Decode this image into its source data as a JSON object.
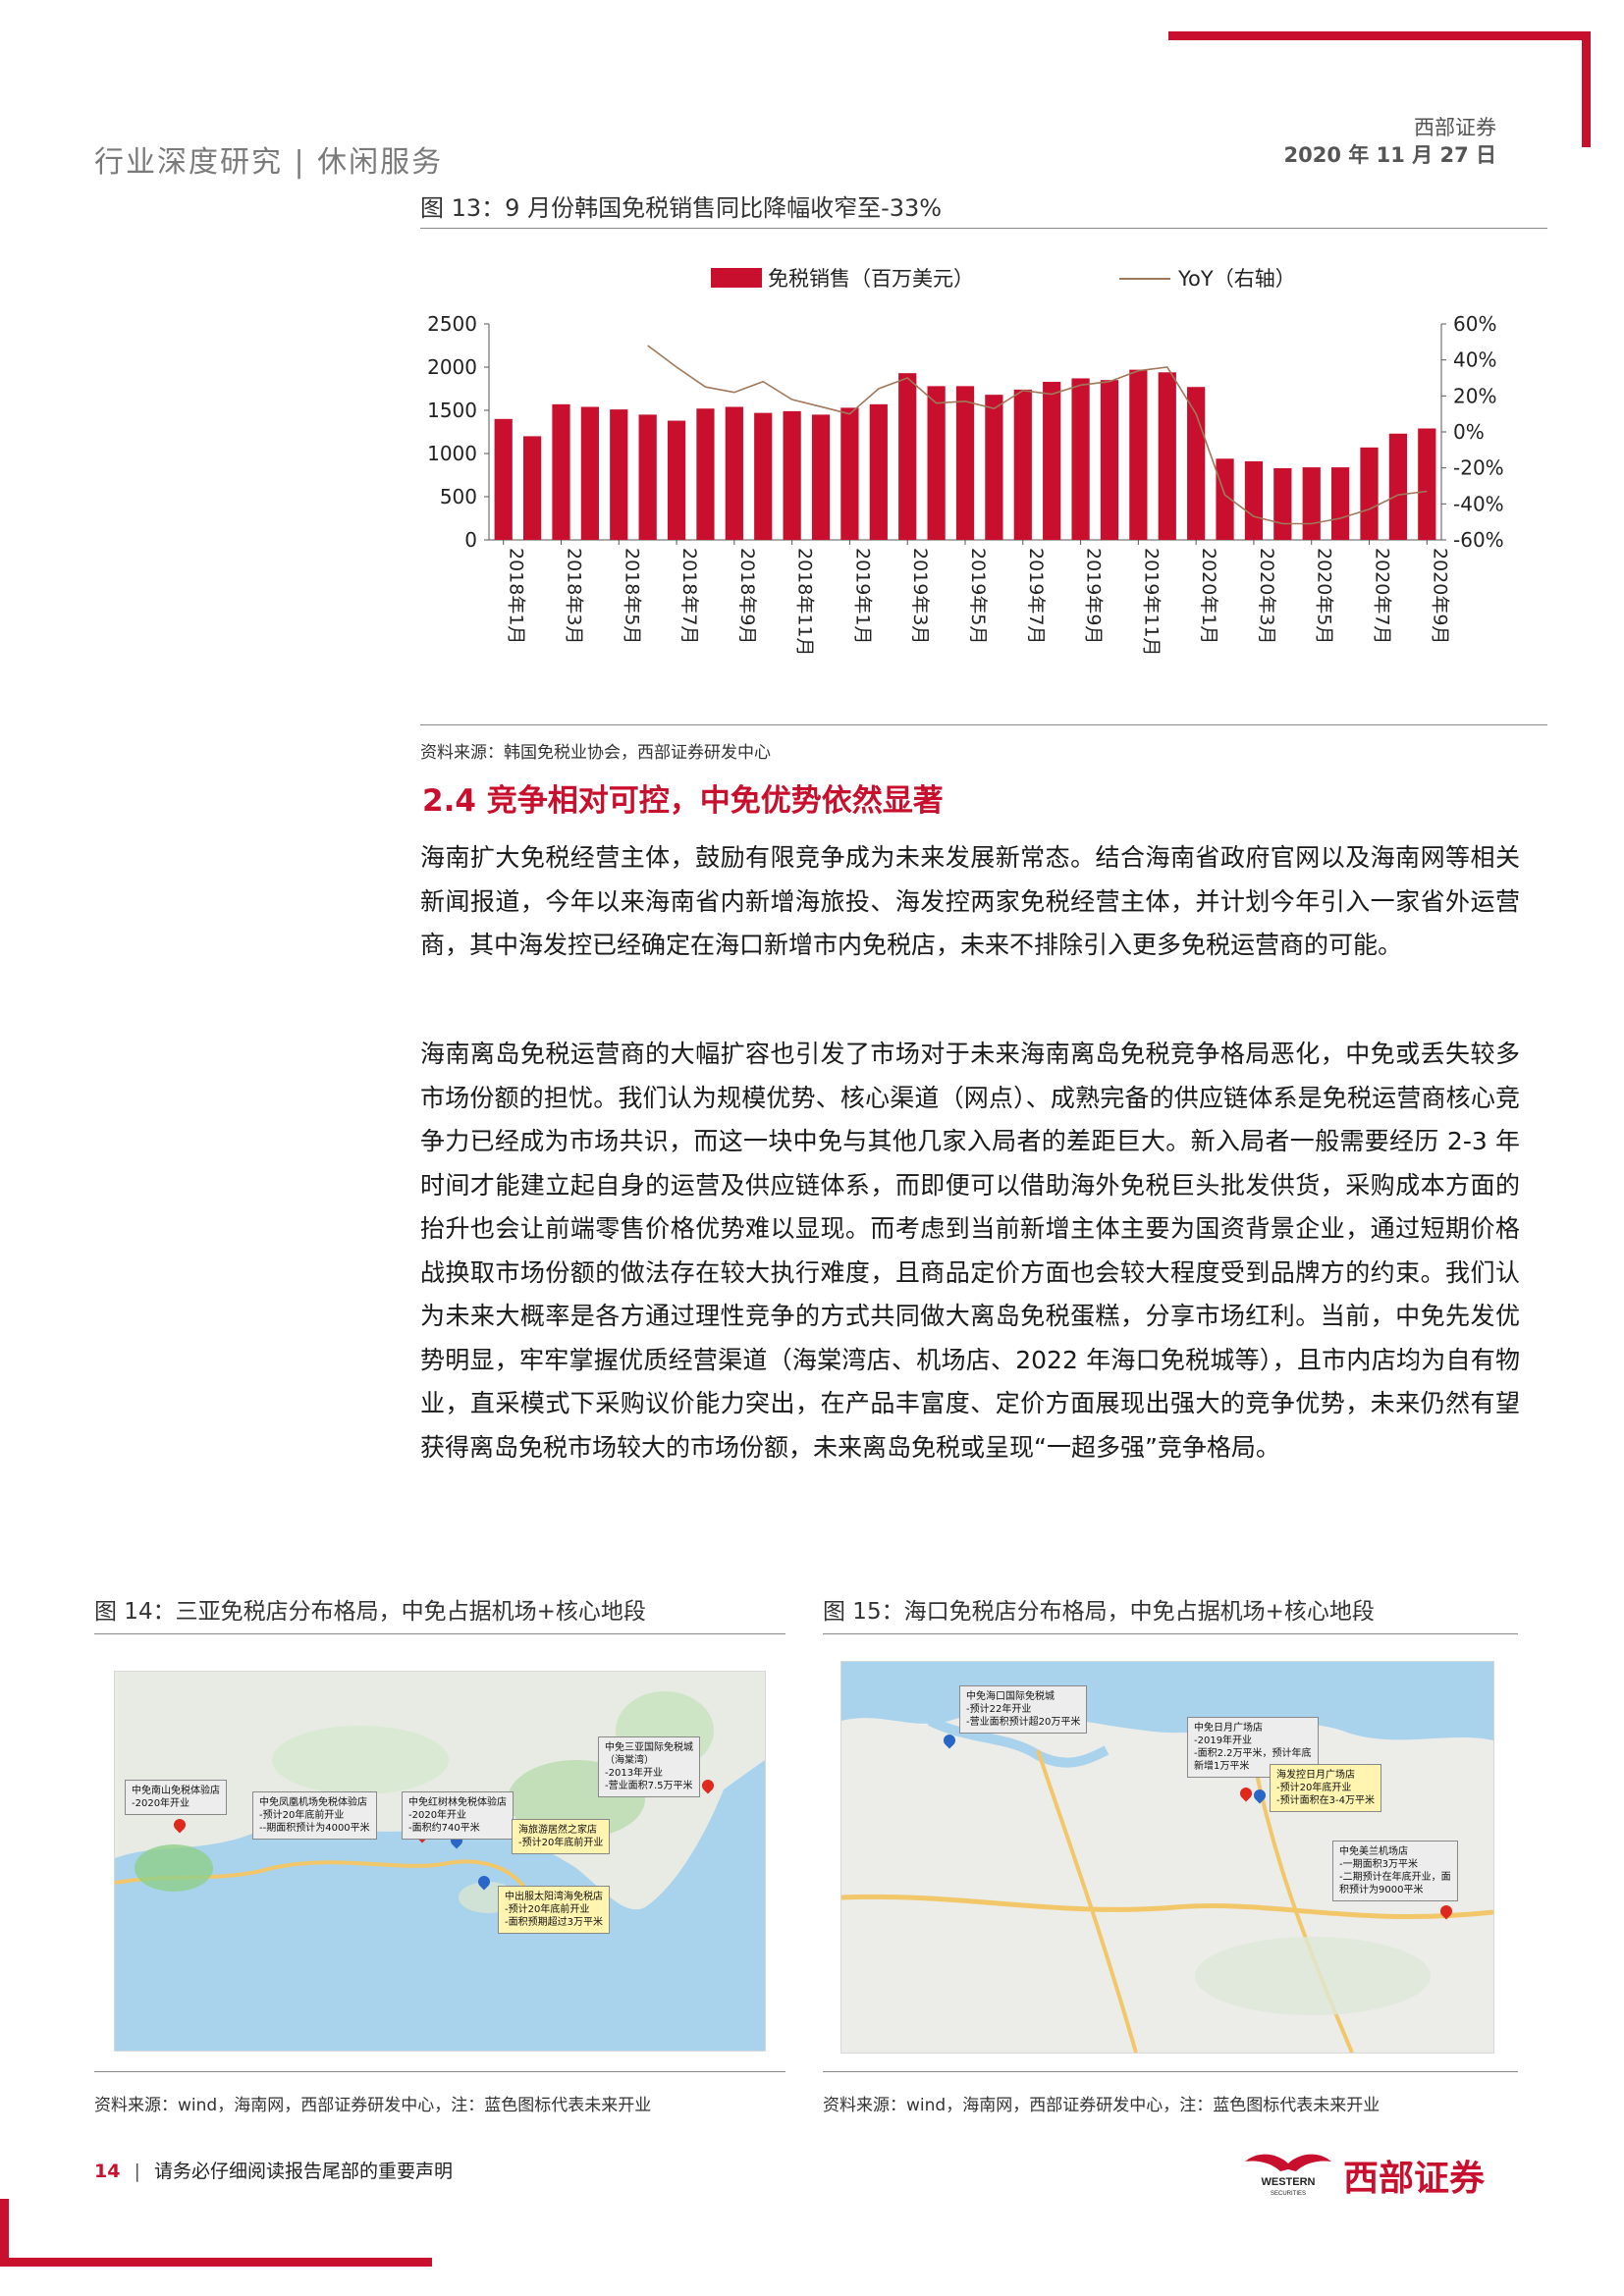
{
  "header": {
    "category": "行业深度研究 | 休闲服务",
    "company": "西部证券",
    "date": "2020 年 11 月 27 日"
  },
  "figure13": {
    "title": "图 13：9 月份韩国免税销售同比降幅收窄至-33%",
    "source": "资料来源：韩国免税业协会，西部证券研发中心"
  },
  "chart_data": {
    "type": "bar",
    "title": "图 13：9 月份韩国免税销售同比降幅收窄至-33%",
    "categories": [
      "2018年1月",
      "2018年2月",
      "2018年3月",
      "2018年4月",
      "2018年5月",
      "2018年6月",
      "2018年7月",
      "2018年8月",
      "2018年9月",
      "2018年10月",
      "2018年11月",
      "2018年12月",
      "2019年1月",
      "2019年2月",
      "2019年3月",
      "2019年4月",
      "2019年5月",
      "2019年6月",
      "2019年7月",
      "2019年8月",
      "2019年9月",
      "2019年10月",
      "2019年11月",
      "2019年12月",
      "2020年1月",
      "2020年2月",
      "2020年3月",
      "2020年4月",
      "2020年5月",
      "2020年6月",
      "2020年7月",
      "2020年8月",
      "2020年9月"
    ],
    "tick_labels": [
      "2018年1月",
      "2018年3月",
      "2018年5月",
      "2018年7月",
      "2018年9月",
      "2018年11月",
      "2019年1月",
      "2019年3月",
      "2019年5月",
      "2019年7月",
      "2019年9月",
      "2019年11月",
      "2020年1月",
      "2020年3月",
      "2020年5月",
      "2020年7月",
      "2020年9月"
    ],
    "series": [
      {
        "name": "免税销售（百万美元）",
        "type": "bar",
        "axis": "left",
        "color": "#c8102e",
        "values": [
          1400,
          1200,
          1570,
          1540,
          1510,
          1450,
          1380,
          1520,
          1540,
          1470,
          1490,
          1450,
          1530,
          1570,
          1930,
          1780,
          1780,
          1680,
          1740,
          1830,
          1870,
          1850,
          1970,
          1940,
          1770,
          940,
          910,
          830,
          840,
          840,
          1070,
          1230,
          1290
        ]
      },
      {
        "name": "YoY（右轴）",
        "type": "line",
        "axis": "right",
        "color": "#a0785a",
        "values": [
          null,
          null,
          null,
          null,
          null,
          48,
          36,
          25,
          22,
          28,
          18,
          14,
          10,
          24,
          30,
          16,
          17,
          13,
          23,
          21,
          26,
          28,
          34,
          36,
          10,
          -35,
          -47,
          -51,
          -51,
          -48,
          -43,
          -35,
          -33
        ]
      }
    ],
    "y_left": {
      "min": 0,
      "max": 2500,
      "ticks": [
        "0",
        "500",
        "1000",
        "1500",
        "2000",
        "2500"
      ]
    },
    "y_right": {
      "min": -60,
      "max": 60,
      "ticks": [
        "-60%",
        "-40%",
        "-20%",
        "0%",
        "20%",
        "40%",
        "60%"
      ]
    },
    "legend_position": "top",
    "grid": false
  },
  "section": {
    "title": "2.4 竞争相对可控，中免优势依然显著"
  },
  "paragraphs": [
    "海南扩大免税经营主体，鼓励有限竞争成为未来发展新常态。结合海南省政府官网以及海南网等相关新闻报道，今年以来海南省内新增海旅投、海发控两家免税经营主体，并计划今年引入一家省外运营商，其中海发控已经确定在海口新增市内免税店，未来不排除引入更多免税运营商的可能。",
    "海南离岛免税运营商的大幅扩容也引发了市场对于未来海南离岛免税竞争格局恶化，中免或丢失较多市场份额的担忧。我们认为规模优势、核心渠道（网点）、成熟完备的供应链体系是免税运营商核心竞争力已经成为市场共识，而这一块中免与其他几家入局者的差距巨大。新入局者一般需要经历 2-3 年时间才能建立起自身的运营及供应链体系，而即便可以借助海外免税巨头批发供货，采购成本方面的抬升也会让前端零售价格优势难以显现。而考虑到当前新增主体主要为国资背景企业，通过短期价格战换取市场份额的做法存在较大执行难度，且商品定价方面也会较大程度受到品牌方的约束。我们认为未来大概率是各方通过理性竞争的方式共同做大离岛免税蛋糕，分享市场红利。当前，中免先发优势明显，牢牢掌握优质经营渠道（海棠湾店、机场店、2022 年海口免税城等），且市内店均为自有物业，直采模式下采购议价能力突出，在产品丰富度、定价方面展现出强大的竞争优势，未来仍然有望获得离岛免税市场较大的市场份额，未来离岛免税或呈现“一超多强”竞争格局。"
  ],
  "figure14": {
    "title": "图 14：三亚免税店分布格局，中免占据机场+核心地段",
    "source": "资料来源：wind，海南网，西部证券研发中心，注：蓝色图标代表未来开业",
    "callouts": [
      {
        "text": "中免三亚国际免税城\n（海棠湾）\n-2013年开业\n-营业面积7.5万平米",
        "style": "gray"
      },
      {
        "text": "中免南山免税体验店\n-2020年开业",
        "style": "gray"
      },
      {
        "text": "中免凤凰机场免税体验店\n-预计20年底前开业\n--期面积预计为4000平米",
        "style": "gray"
      },
      {
        "text": "中免红树林免税体验店\n-2020年开业\n-面积约740平米",
        "style": "gray"
      },
      {
        "text": "海旅游居然之家店\n-预计20年底前开业",
        "style": "yellow"
      },
      {
        "text": "中出服太阳湾海免税店\n-预计20年底前开业\n-面积预期超过3万平米",
        "style": "yellow"
      }
    ]
  },
  "figure15": {
    "title": "图 15：海口免税店分布格局，中免占据机场+核心地段",
    "source": "资料来源：wind，海南网，西部证券研发中心，注：蓝色图标代表未来开业",
    "callouts": [
      {
        "text": "中免海口国际免税城\n-预计22年开业\n-营业面积预计超20万平米",
        "style": "gray"
      },
      {
        "text": "中免日月广场店\n-2019年开业\n-面积2.2万平米，预计年底\n新增1万平米",
        "style": "gray"
      },
      {
        "text": "海发控日月广场店\n-预计20年底开业\n-预计面积在3-4万平米",
        "style": "yellow"
      },
      {
        "text": "中免美兰机场店\n-一期面积3万平米\n-二期预计在年底开业，面\n积预计为9000平米",
        "style": "gray"
      }
    ]
  },
  "footer": {
    "page_number": "14",
    "note": "请务必仔细阅读报告尾部的重要声明",
    "logo_cn": "西部证券",
    "logo_en": "WESTERN",
    "logo_en_sub": "SECURITIES"
  }
}
